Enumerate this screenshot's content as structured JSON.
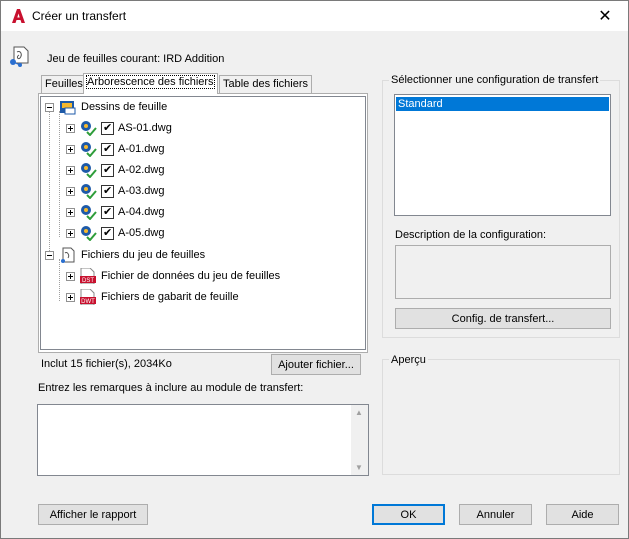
{
  "window": {
    "title": "Créer un transfert",
    "close_glyph": "✕"
  },
  "sheet_set": {
    "current_label": "Jeu de feuilles courant: IRD Addition"
  },
  "tabs": [
    {
      "label": "Feuilles",
      "active": false
    },
    {
      "label": "Arborescence des fichiers",
      "active": true
    },
    {
      "label": "Table des fichiers",
      "active": false
    }
  ],
  "tree": {
    "root1": {
      "label": "Dessins de feuille",
      "expanded": true,
      "icon": "drawing-folder-icon",
      "items": [
        {
          "label": "AS-01.dwg",
          "checked": true,
          "icon": "dwg-file-icon"
        },
        {
          "label": "A-01.dwg",
          "checked": true,
          "icon": "dwg-file-icon"
        },
        {
          "label": "A-02.dwg",
          "checked": true,
          "icon": "dwg-file-icon"
        },
        {
          "label": "A-03.dwg",
          "checked": true,
          "icon": "dwg-file-icon"
        },
        {
          "label": "A-04.dwg",
          "checked": true,
          "icon": "dwg-file-icon"
        },
        {
          "label": "A-05.dwg",
          "checked": true,
          "icon": "dwg-file-icon"
        }
      ]
    },
    "root2": {
      "label": "Fichiers du jeu de feuilles",
      "expanded": true,
      "icon": "sheetset-files-icon",
      "items": [
        {
          "label": "Fichier de données du jeu de feuilles",
          "icon": "dst-file-icon",
          "badge": "DST"
        },
        {
          "label": "Fichiers de gabarit de feuille",
          "icon": "dwt-file-icon",
          "badge": "DWT"
        }
      ]
    }
  },
  "status": {
    "included": "Inclut 15 fichier(s), 2034Ko"
  },
  "buttons": {
    "add_file": "Ajouter fichier...",
    "transfer_setup": "Config. de transfert...",
    "view_report": "Afficher le rapport",
    "ok": "OK",
    "cancel": "Annuler",
    "help": "Aide"
  },
  "notes": {
    "label": "Entrez les remarques à inclure au module de transfert:",
    "value": ""
  },
  "config": {
    "group_title": "Sélectionner une configuration de transfert",
    "items": [
      "Standard"
    ],
    "selected": "Standard",
    "description_label": "Description de la configuration:",
    "description_value": ""
  },
  "preview": {
    "group_title": "Aperçu"
  },
  "colors": {
    "selection": "#0078d7",
    "dialog_bg": "#f0f0f0",
    "dwg_blue": "#1e5aa8",
    "check_green": "#2e9d3a",
    "autocad_red": "#c8102e"
  }
}
